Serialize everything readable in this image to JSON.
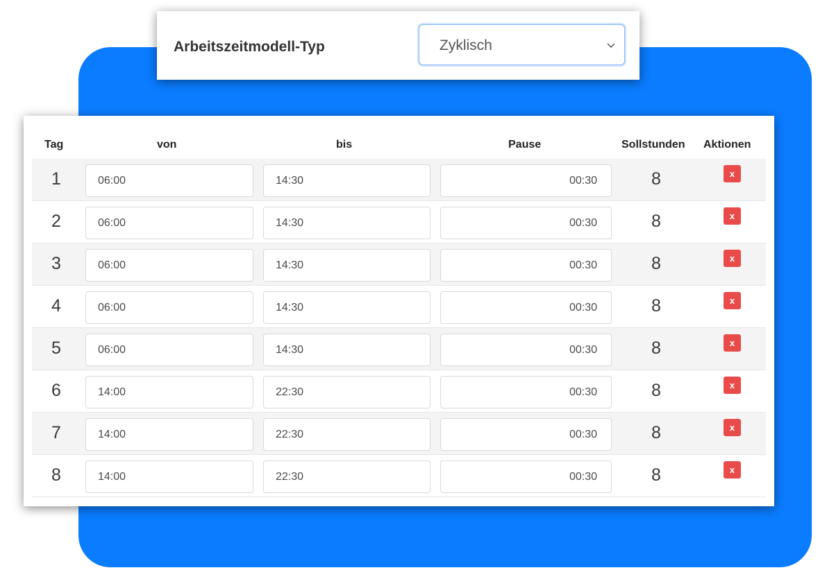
{
  "model_type": {
    "label": "Arbeitszeitmodell-Typ",
    "selected": "Zyklisch"
  },
  "table": {
    "headers": {
      "day": "Tag",
      "from": "von",
      "to": "bis",
      "break": "Pause",
      "target_hours": "Sollstunden",
      "actions": "Aktionen"
    },
    "rows": [
      {
        "day": "1",
        "from": "06:00",
        "to": "14:30",
        "break": "00:30",
        "hours": "8",
        "delete": "x"
      },
      {
        "day": "2",
        "from": "06:00",
        "to": "14:30",
        "break": "00:30",
        "hours": "8",
        "delete": "x"
      },
      {
        "day": "3",
        "from": "06:00",
        "to": "14:30",
        "break": "00:30",
        "hours": "8",
        "delete": "x"
      },
      {
        "day": "4",
        "from": "06:00",
        "to": "14:30",
        "break": "00:30",
        "hours": "8",
        "delete": "x"
      },
      {
        "day": "5",
        "from": "06:00",
        "to": "14:30",
        "break": "00:30",
        "hours": "8",
        "delete": "x"
      },
      {
        "day": "6",
        "from": "14:00",
        "to": "22:30",
        "break": "00:30",
        "hours": "8",
        "delete": "x"
      },
      {
        "day": "7",
        "from": "14:00",
        "to": "22:30",
        "break": "00:30",
        "hours": "8",
        "delete": "x"
      },
      {
        "day": "8",
        "from": "14:00",
        "to": "22:30",
        "break": "00:30",
        "hours": "8",
        "delete": "x"
      }
    ]
  },
  "colors": {
    "background_panel": "#0a7cff",
    "delete_button": "#e94b4b",
    "row_stripe": "#f4f4f4"
  },
  "icons": {
    "select_chevron": "chevron-down-icon",
    "delete": "close-icon"
  }
}
